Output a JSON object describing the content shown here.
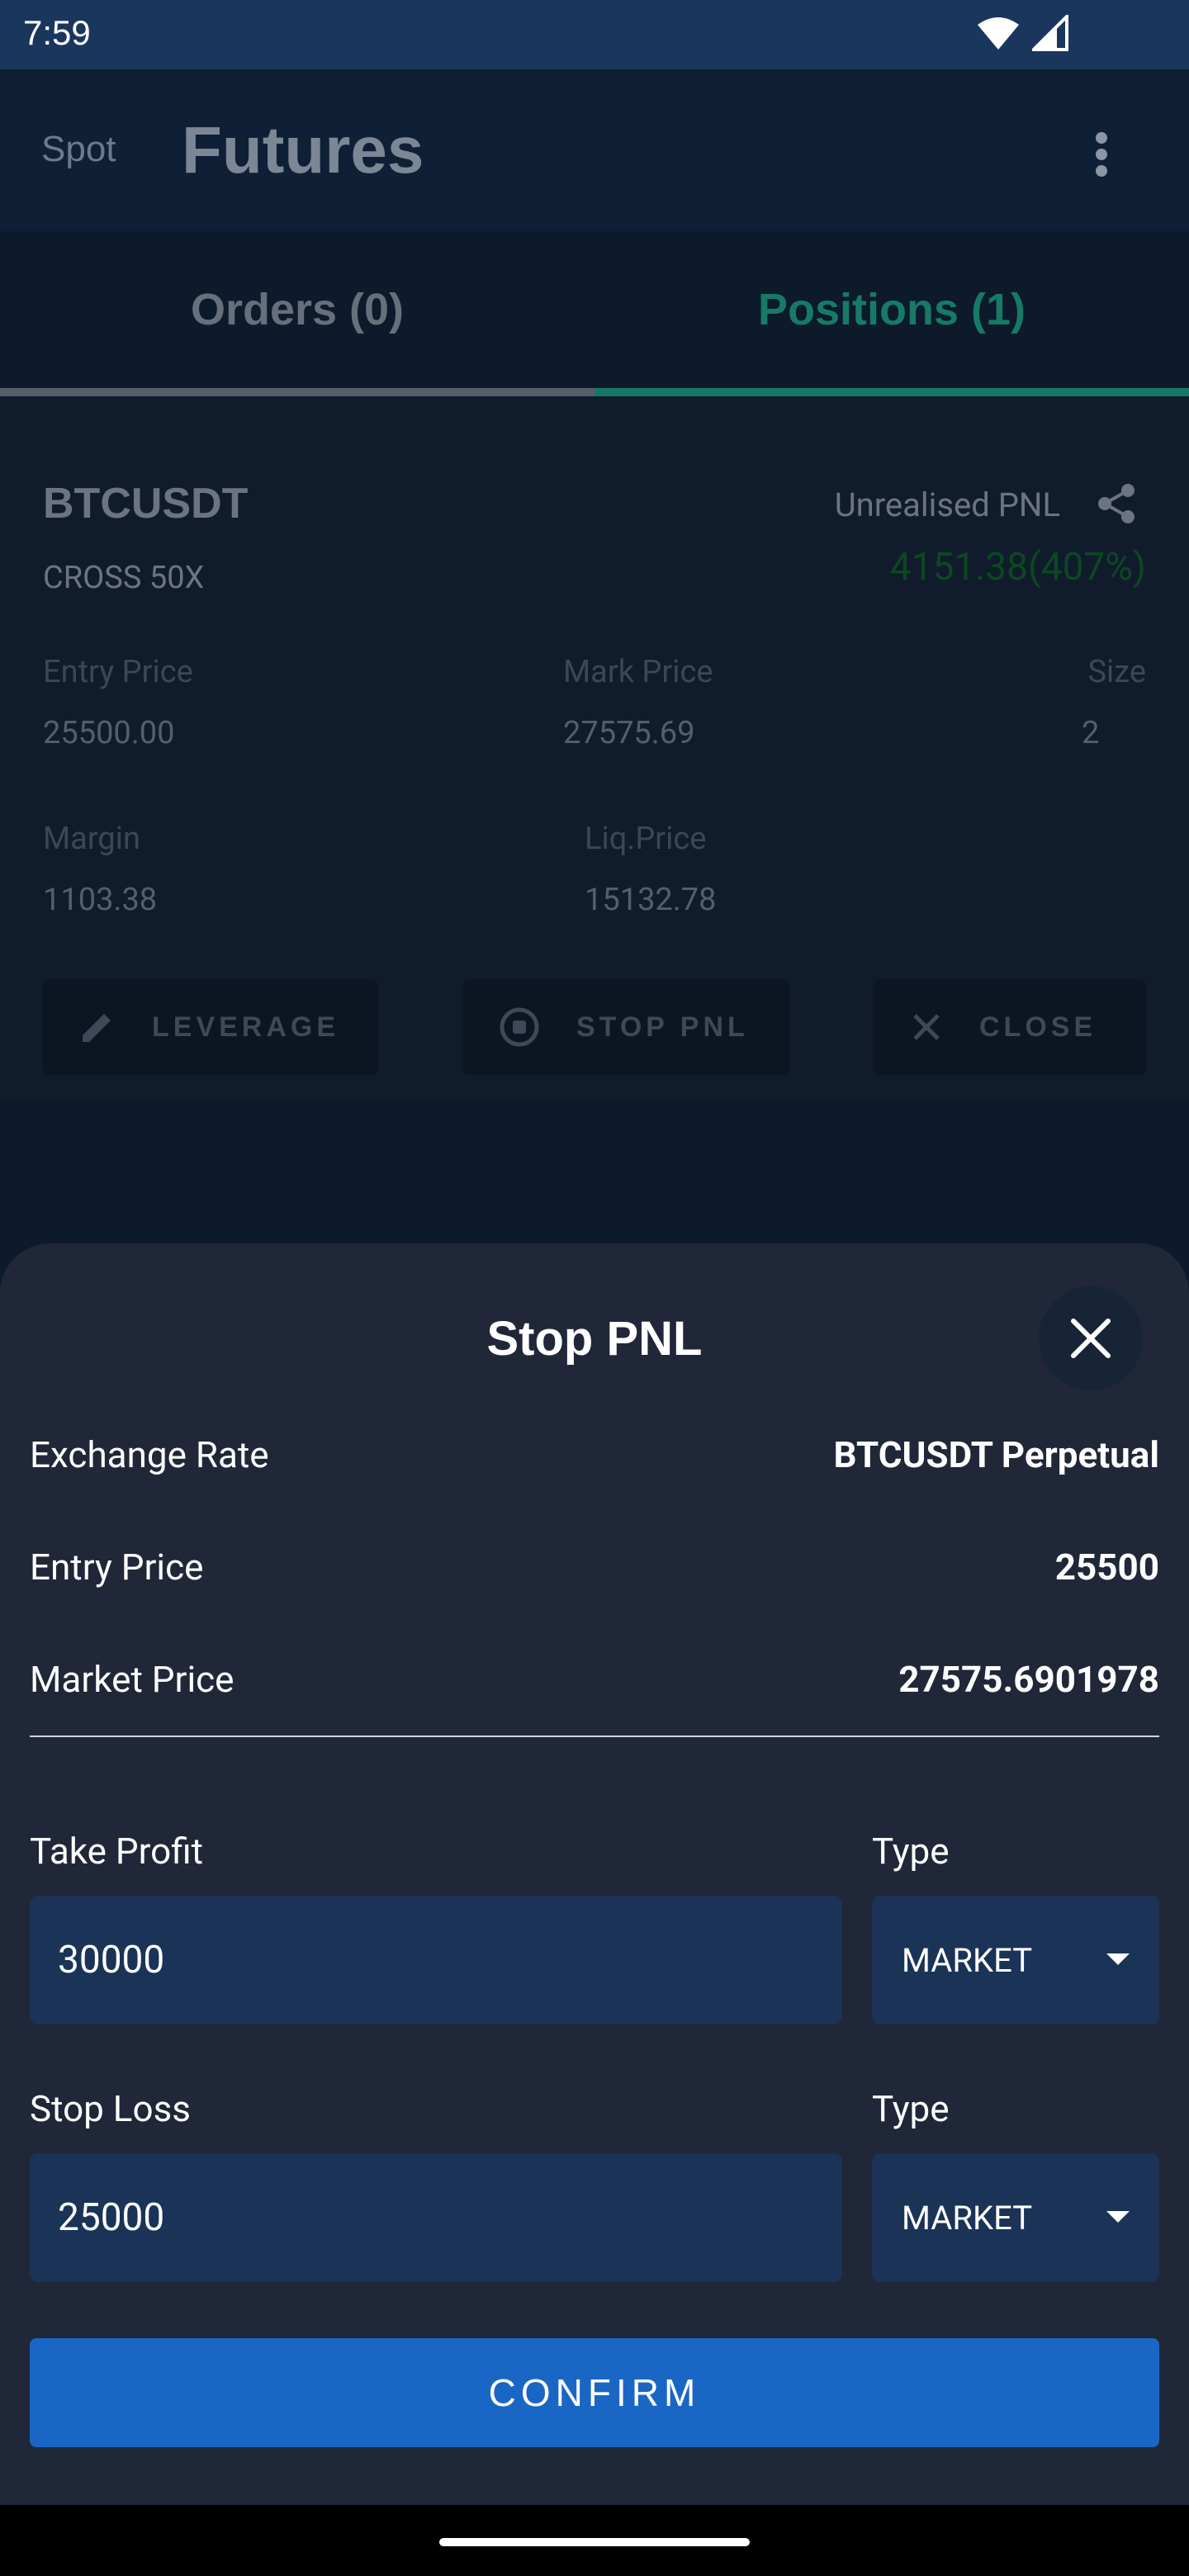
{
  "status_bar": {
    "time": "7:59"
  },
  "app_bar": {
    "spot_label": "Spot",
    "title": "Futures"
  },
  "tabs": [
    {
      "label": "Orders (0)"
    },
    {
      "label": "Positions (1)"
    }
  ],
  "position": {
    "symbol": "BTCUSDT",
    "mode": "CROSS 50X",
    "unrealised_pnl_label": "Unrealised PNL",
    "unrealised_pnl_value": "4151.38(407%)",
    "entry_price_label": "Entry Price",
    "entry_price": "25500.00",
    "mark_price_label": "Mark Price",
    "mark_price": "27575.69",
    "size_label": "Size",
    "size": "2",
    "margin_label": "Margin",
    "margin": "1103.38",
    "liq_price_label": "Liq.Price",
    "liq_price": "15132.78",
    "buttons": {
      "leverage": "LEVERAGE",
      "stop_pnl": "STOP PNL",
      "close": "CLOSE"
    }
  },
  "sheet": {
    "title": "Stop PNL",
    "rows": [
      {
        "label": "Exchange Rate",
        "value": "BTCUSDT Perpetual"
      },
      {
        "label": "Entry Price",
        "value": "25500"
      },
      {
        "label": "Market Price",
        "value": "27575.6901978"
      }
    ],
    "take_profit": {
      "label": "Take Profit",
      "value": "30000",
      "type_label": "Type",
      "type_value": "MARKET"
    },
    "stop_loss": {
      "label": "Stop Loss",
      "value": "25000",
      "type_label": "Type",
      "type_value": "MARKET"
    },
    "confirm_label": "CONFIRM"
  },
  "colors": {
    "accent_green": "#157765",
    "primary_blue": "#1a66c4",
    "sheet_bg": "#1f2738",
    "field_bg": "#1a3356"
  }
}
